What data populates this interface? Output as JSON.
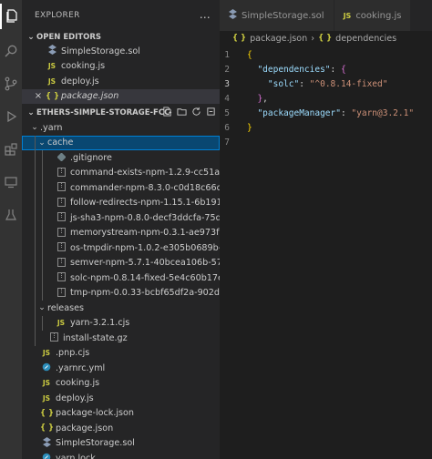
{
  "sidebar": {
    "title": "EXPLORER",
    "more_icon": "…"
  },
  "open_editors": {
    "label": "OPEN EDITORS",
    "items": [
      {
        "name": "SimpleStorage.sol",
        "icon": "sol"
      },
      {
        "name": "cooking.js",
        "icon": "js"
      },
      {
        "name": "deploy.js",
        "icon": "js"
      },
      {
        "name": "package.json",
        "icon": "json",
        "active": true
      }
    ]
  },
  "project": {
    "label": "ETHERS-SIMPLE-STORAGE-FCC",
    "tree": [
      {
        "name": ".yarn",
        "type": "folder",
        "depth": 0,
        "expanded": true
      },
      {
        "name": "cache",
        "type": "folder",
        "depth": 1,
        "expanded": true,
        "selected": true
      },
      {
        "name": ".gitignore",
        "type": "file",
        "icon": "gitignore",
        "depth": 2
      },
      {
        "name": "command-exists-npm-1.2.9-cc51a1f78a-7...",
        "type": "file",
        "icon": "archive",
        "depth": 2
      },
      {
        "name": "commander-npm-8.3.0-c0d18c66d5-0fe2...",
        "type": "file",
        "icon": "archive",
        "depth": 2
      },
      {
        "name": "follow-redirects-npm-1.15.1-6b191885cd...",
        "type": "file",
        "icon": "archive",
        "depth": 2
      },
      {
        "name": "js-sha3-npm-0.8.0-decf3ddcfa-75df77c1fc...",
        "type": "file",
        "icon": "archive",
        "depth": 2
      },
      {
        "name": "memorystream-npm-0.3.1-ae973f1d16-f1...",
        "type": "file",
        "icon": "archive",
        "depth": 2
      },
      {
        "name": "os-tmpdir-npm-1.0.2-e305b0689b-56665...",
        "type": "file",
        "icon": "archive",
        "depth": 2
      },
      {
        "name": "semver-npm-5.7.1-40bcea106b-57fd0acf...",
        "type": "file",
        "icon": "archive",
        "depth": 2
      },
      {
        "name": "solc-npm-0.8.14-fixed-5e4c60b17e-1b85...",
        "type": "file",
        "icon": "archive",
        "depth": 2
      },
      {
        "name": "tmp-npm-0.0.33-bcbf65df2a-902d7aceb7...",
        "type": "file",
        "icon": "archive",
        "depth": 2
      },
      {
        "name": "releases",
        "type": "folder",
        "depth": 1,
        "expanded": true
      },
      {
        "name": "yarn-3.2.1.cjs",
        "type": "file",
        "icon": "js",
        "depth": 2
      },
      {
        "name": "install-state.gz",
        "type": "file",
        "icon": "archive",
        "depth": 1
      },
      {
        "name": ".pnp.cjs",
        "type": "file",
        "icon": "js",
        "depth": 0
      },
      {
        "name": ".yarnrc.yml",
        "type": "file",
        "icon": "yarn",
        "depth": 0
      },
      {
        "name": "cooking.js",
        "type": "file",
        "icon": "js",
        "depth": 0
      },
      {
        "name": "deploy.js",
        "type": "file",
        "icon": "js",
        "depth": 0
      },
      {
        "name": "package-lock.json",
        "type": "file",
        "icon": "json",
        "depth": 0
      },
      {
        "name": "package.json",
        "type": "file",
        "icon": "json",
        "depth": 0
      },
      {
        "name": "SimpleStorage.sol",
        "type": "file",
        "icon": "sol",
        "depth": 0
      },
      {
        "name": "yarn.lock",
        "type": "file",
        "icon": "yarn",
        "depth": 0
      }
    ]
  },
  "editor": {
    "tabs": [
      {
        "label": "SimpleStorage.sol",
        "icon": "sol"
      },
      {
        "label": "cooking.js",
        "icon": "js"
      }
    ],
    "breadcrumb": [
      "package.json",
      "dependencies"
    ],
    "lines": [
      {
        "n": "1",
        "tokens": [
          {
            "t": "{",
            "c": "b1"
          }
        ]
      },
      {
        "n": "2",
        "tokens": [
          {
            "t": "  \"dependencies\"",
            "c": "k"
          },
          {
            "t": ": ",
            "c": "p"
          },
          {
            "t": "{",
            "c": "b2"
          }
        ]
      },
      {
        "n": "3",
        "tokens": [
          {
            "t": "    \"solc\"",
            "c": "k"
          },
          {
            "t": ": ",
            "c": "p"
          },
          {
            "t": "\"^0.8.14-fixed\"",
            "c": "s"
          }
        ]
      },
      {
        "n": "4",
        "tokens": [
          {
            "t": "  }",
            "c": "b2"
          },
          {
            "t": ",",
            "c": "p"
          }
        ]
      },
      {
        "n": "5",
        "tokens": [
          {
            "t": "  \"packageManager\"",
            "c": "k"
          },
          {
            "t": ": ",
            "c": "p"
          },
          {
            "t": "\"yarn@3.2.1\"",
            "c": "s"
          }
        ]
      },
      {
        "n": "6",
        "tokens": [
          {
            "t": "}",
            "c": "b1"
          }
        ]
      },
      {
        "n": "7",
        "tokens": []
      }
    ]
  },
  "icons": {
    "js": "JS",
    "json": "{ }",
    "sol": "S",
    "close": "×",
    "chevron_down": "⌄",
    "chevron_right": "›"
  }
}
